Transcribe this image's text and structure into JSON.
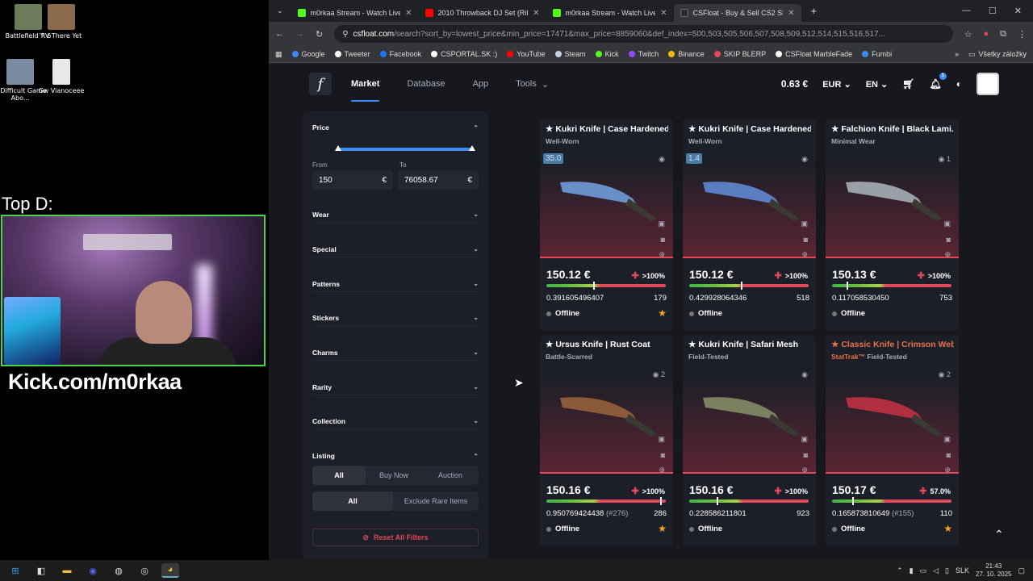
{
  "desktop": {
    "icons": [
      {
        "label": "Battlefield™ 6",
        "color": "#6b7c5a"
      },
      {
        "label": "RV There Yet",
        "color": "#8a6a4a"
      },
      {
        "label": "A Difficult Game Abo...",
        "color": "#7a8aa0"
      },
      {
        "label": "Gw Vianoceee",
        "color": "#e8e8e8"
      }
    ],
    "cam_title": "Top D:",
    "kick_text": "Kick.com/m0rkaa"
  },
  "browser": {
    "tabs": [
      {
        "title": "m0rkaa Stream - Watch Live on",
        "color": "#53fc18",
        "active": false
      },
      {
        "title": "2010 Throwback DJ Set (Rihann",
        "color": "#ff0000",
        "active": false
      },
      {
        "title": "m0rkaa Stream - Watch Live on",
        "color": "#53fc18",
        "active": false
      },
      {
        "title": "CSFloat - Buy & Sell CS2 Skins",
        "color": "#2b2f3a",
        "active": true
      }
    ],
    "url_host": "csfloat.com",
    "url_path": "/search?sort_by=lowest_price&min_price=17471&max_price=8859060&def_index=500,503,505,506,507,508,509,512,514,515,516,517...",
    "bookmarks": [
      {
        "label": "Google",
        "color": "#4285f4"
      },
      {
        "label": "Tweeter",
        "color": "#ffffff"
      },
      {
        "label": "Facebook",
        "color": "#1877f2"
      },
      {
        "label": "CSPORTAL.SK :)",
        "color": "#ffffff"
      },
      {
        "label": "YouTube",
        "color": "#ff0000"
      },
      {
        "label": "Steam",
        "color": "#c7d5e0"
      },
      {
        "label": "Kick",
        "color": "#53fc18"
      },
      {
        "label": "Twitch",
        "color": "#9146ff"
      },
      {
        "label": "Binance",
        "color": "#f0b90b"
      },
      {
        "label": "SKIP BLERP",
        "color": "#e2485a"
      },
      {
        "label": "CSFloat MarbleFade",
        "color": "#ffffff"
      },
      {
        "label": "Fumbi",
        "color": "#3d8bfd"
      }
    ],
    "bookmarks_right": "Všetky záložky"
  },
  "site": {
    "logo": "f",
    "nav": [
      "Market",
      "Database",
      "App",
      "Tools"
    ],
    "balance": "0.63 €",
    "currency": "EUR",
    "language": "EN",
    "notif_count": "1",
    "accent": "#3d8bfd",
    "filters": {
      "price_label": "Price",
      "from_label": "From",
      "to_label": "To",
      "from_value": "150",
      "to_value": "76058.67",
      "currency_symbol": "€",
      "sections": [
        "Wear",
        "Special",
        "Patterns",
        "Stickers",
        "Charms",
        "Rarity",
        "Collection",
        "Listing"
      ],
      "listing_type": [
        "All",
        "Buy Now",
        "Auction"
      ],
      "rarity_filter": [
        "All",
        "Exclude Rare Items"
      ],
      "reset": "Reset All Filters"
    },
    "cards": [
      {
        "name": "★ Kukri Knife | Case Hardened",
        "wear": "Well-Worn",
        "stattrak": "",
        "pattern": "35.0",
        "views": "",
        "price": "150.12 €",
        "pct": ">100%",
        "float": "0.391605496407",
        "rank": "",
        "count": "179",
        "status": "Offline",
        "star": true,
        "float_frac": 0.39,
        "blade": "#6a8ec8"
      },
      {
        "name": "★ Kukri Knife | Case Hardened",
        "wear": "Well-Worn",
        "stattrak": "",
        "pattern": "1.4",
        "views": "",
        "price": "150.12 €",
        "pct": ">100%",
        "float": "0.429928064346",
        "rank": "",
        "count": "518",
        "status": "Offline",
        "star": false,
        "float_frac": 0.43,
        "blade": "#5a7ec0"
      },
      {
        "name": "★ Falchion Knife | Black Lami...",
        "wear": "Minimal Wear",
        "stattrak": "",
        "pattern": "",
        "views": "1",
        "price": "150.13 €",
        "pct": ">100%",
        "float": "0.117058530450",
        "rank": "",
        "count": "753",
        "status": "Offline",
        "star": false,
        "float_frac": 0.12,
        "blade": "#9aa0a8"
      },
      {
        "name": "★ Ursus Knife | Rust Coat",
        "wear": "Battle-Scarred",
        "stattrak": "",
        "pattern": "",
        "views": "2",
        "price": "150.16 €",
        "pct": ">100%",
        "float": "0.950769424438",
        "rank": "(#276)",
        "count": "286",
        "status": "Offline",
        "star": true,
        "float_frac": 0.95,
        "blade": "#8a5a3a"
      },
      {
        "name": "★ Kukri Knife | Safari Mesh",
        "wear": "Field-Tested",
        "stattrak": "",
        "pattern": "",
        "views": "",
        "price": "150.16 €",
        "pct": ">100%",
        "float": "0.228586211801",
        "rank": "",
        "count": "923",
        "status": "Offline",
        "star": false,
        "float_frac": 0.23,
        "blade": "#7a8060"
      },
      {
        "name": "★ Classic Knife | Crimson Web",
        "wear": "Field-Tested",
        "stattrak": "StatTrak™",
        "pattern": "",
        "views": "2",
        "price": "150.17 €",
        "pct": "57.0%",
        "float": "0.165873810649",
        "rank": "(#155)",
        "count": "110",
        "status": "Offline",
        "star": true,
        "float_frac": 0.17,
        "blade": "#b03040"
      }
    ]
  },
  "taskbar": {
    "lang": "SLK",
    "time": "21:43",
    "date": "27. 10. 2025"
  }
}
